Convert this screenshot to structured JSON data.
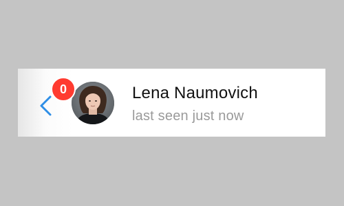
{
  "chat_header": {
    "unread_count": "0",
    "contact_name": "Lena Naumovich",
    "status": "last seen just now",
    "back_icon": "chevron-left-icon",
    "colors": {
      "accent": "#2f8ee6",
      "badge": "#ff3b30",
      "status_text": "#9a9a9a",
      "background": "#c4c4c4",
      "bar": "#ffffff"
    }
  }
}
